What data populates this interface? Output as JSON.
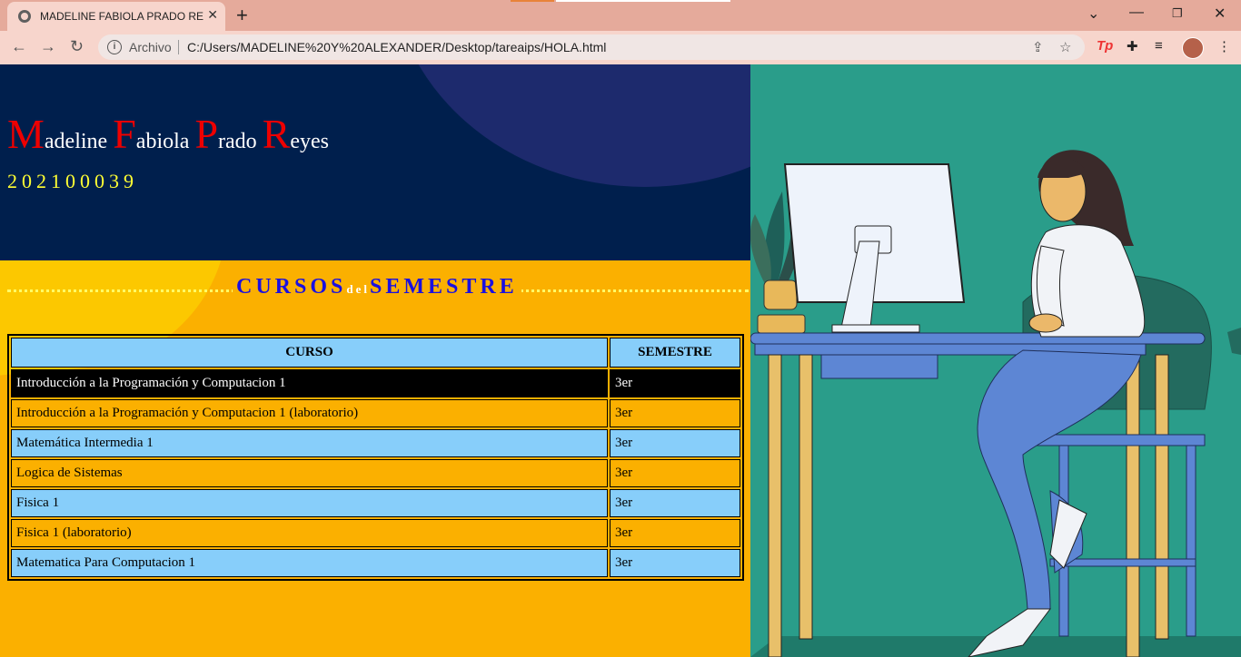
{
  "browser": {
    "tab_title": "MADELINE FABIOLA PRADO REYES",
    "new_tab_symbol": "+",
    "omnibox_label": "Archivo",
    "url": "C:/Users/MADELINE%20Y%20ALEXANDER/Desktop/tareaips/HOLA.html",
    "extension_tp": "Tp"
  },
  "header": {
    "name_parts": [
      {
        "cap": "M",
        "rest": "adeline "
      },
      {
        "cap": "F",
        "rest": "abiola "
      },
      {
        "cap": "P",
        "rest": "rado "
      },
      {
        "cap": "R",
        "rest": "eyes"
      }
    ],
    "carnet": "202100039"
  },
  "section": {
    "title_a": "CURSOS",
    "title_b": "del",
    "title_c": "SEMESTRE"
  },
  "table": {
    "headers": [
      "CURSO",
      "SEMESTRE"
    ],
    "rows": [
      {
        "curso": "Introducción a la Programación y Computacion 1",
        "semestre": "3er"
      },
      {
        "curso": "Introducción a la Programación y Computacion 1 (laboratorio)",
        "semestre": "3er"
      },
      {
        "curso": "Matemática Intermedia 1",
        "semestre": "3er"
      },
      {
        "curso": "Logica de Sistemas",
        "semestre": "3er"
      },
      {
        "curso": "Fisica 1",
        "semestre": "3er"
      },
      {
        "curso": "Fisica 1 (laboratorio)",
        "semestre": "3er"
      },
      {
        "curso": "Matematica Para Computacion 1",
        "semestre": "3er"
      }
    ]
  },
  "colors": {
    "header_bg": "#001f4d",
    "name_capital": "#e00000",
    "carnet": "#ffff33",
    "panel_orange": "#fbb000",
    "panel_teal": "#2a9d8a",
    "row_blue": "#87cefa",
    "title_blue": "#1a10e0"
  },
  "icons": [
    "globe-favicon",
    "close-icon",
    "back-icon",
    "forward-icon",
    "reload-icon",
    "info-icon",
    "share-icon",
    "star-icon",
    "puzzle-icon",
    "media-icon",
    "menu-icon"
  ]
}
